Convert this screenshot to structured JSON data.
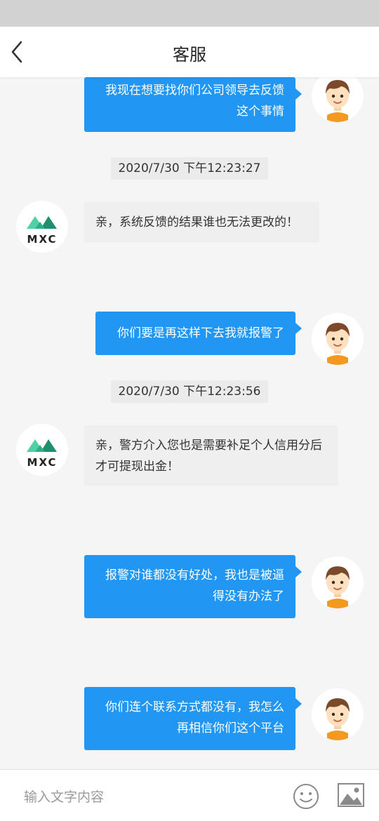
{
  "header": {
    "title": "客服"
  },
  "messages": [
    {
      "side": "user",
      "text": "我现在想要找你们公司领导去反馈这个事情"
    },
    {
      "timestamp": "2020/7/30 下午12:23:27"
    },
    {
      "side": "agent",
      "text": "亲，系统反馈的结果谁也无法更改的！"
    },
    {
      "side": "user",
      "text": "你们要是再这样下去我就报警了"
    },
    {
      "timestamp": "2020/7/30 下午12:23:56"
    },
    {
      "side": "agent",
      "text": "亲，警方介入您也是需要补足个人信用分后才可提现出金！"
    },
    {
      "side": "user",
      "text": "报警对谁都没有好处，我也是被逼得没有办法了"
    },
    {
      "side": "user",
      "text": "你们连个联系方式都没有，我怎么再相信你们这个平台"
    }
  ],
  "agent": {
    "logo_text": "MXC"
  },
  "input": {
    "placeholder": "输入文字内容"
  },
  "colors": {
    "bubble_user": "#2196f3",
    "bubble_agent": "#efefef",
    "logo_green_light": "#4fd1a5",
    "logo_green_dark": "#1e8f70"
  },
  "icons": {
    "back": "chevron-left-icon",
    "emoji": "smiley-icon",
    "image": "image-icon"
  }
}
